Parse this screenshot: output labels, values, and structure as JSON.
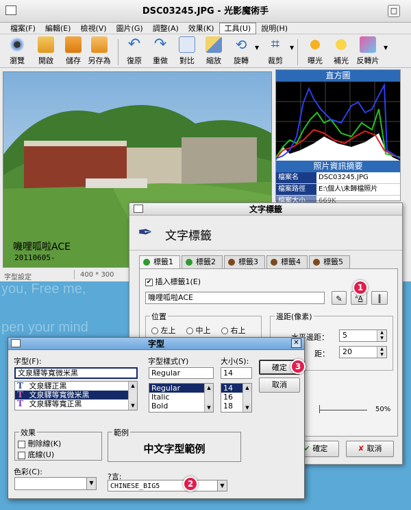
{
  "window": {
    "title": "DSC03245.JPG - 光影魔術手"
  },
  "menu": [
    "檔案(F)",
    "編輯(E)",
    "檢視(V)",
    "圖片(G)",
    "調整(A)",
    "效果(K)",
    "工具(U)",
    "說明(H)"
  ],
  "menu_active_index": 6,
  "toolbar": [
    {
      "label": "瀏覽",
      "icon": "eye-icon"
    },
    {
      "label": "開啟",
      "icon": "folder-icon"
    },
    {
      "label": "儲存",
      "icon": "save-icon"
    },
    {
      "label": "另存為",
      "icon": "save-as-icon"
    },
    {
      "label": "復原",
      "icon": "undo-icon"
    },
    {
      "label": "重做",
      "icon": "redo-icon"
    },
    {
      "label": "對比",
      "icon": "compare-icon"
    },
    {
      "label": "縮放",
      "icon": "resize-icon"
    },
    {
      "label": "旋轉",
      "icon": "rotate-icon"
    },
    {
      "label": "裁剪",
      "icon": "crop-icon"
    },
    {
      "label": "曝光",
      "icon": "exposure-icon"
    },
    {
      "label": "補光",
      "icon": "fill-light-icon"
    },
    {
      "label": "反轉片",
      "icon": "reversal-film-icon"
    }
  ],
  "photo": {
    "caption": "嘰哩呱啦ACE",
    "date": "20110605-"
  },
  "status": {
    "left": "字型設定",
    "size": "400 * 300"
  },
  "side": {
    "histogram_title": "直方圖",
    "info_title": "照片資訊摘要",
    "rows": [
      {
        "k": "檔案名",
        "v": "DSC03245.JPG"
      },
      {
        "k": "檔案路徑",
        "v": "E:\\個人\\未歸檔照片"
      },
      {
        "k": "檔案大小",
        "v": "669K"
      }
    ]
  },
  "background_text": [
    "you, Free me,",
    "pen your mind"
  ],
  "text_dialog": {
    "title": "文字標籤",
    "header": "文字標籤",
    "tabs": [
      {
        "label": "標籤1",
        "color": "#2f9a2f"
      },
      {
        "label": "標籤2",
        "color": "#2f9a2f"
      },
      {
        "label": "標籤3",
        "color": "#7a4a1e"
      },
      {
        "label": "標籤4",
        "color": "#7a4a1e"
      },
      {
        "label": "標籤5",
        "color": "#7a4a1e"
      }
    ],
    "insert_label": "插入標籤1(E)",
    "text_value": "嘰哩呱啦ACE",
    "position_label": "位置",
    "positions": [
      "左上",
      "中上",
      "右上"
    ],
    "margin_label": "邊距(像素)",
    "h_margin_label": "水平邊距：",
    "h_margin": "5",
    "v_margin_label": "距：",
    "v_margin": "20",
    "opacity_value": "50%",
    "ok": "確定",
    "cancel": "取消"
  },
  "font_dialog": {
    "title": "字型",
    "font_label": "字型(F):",
    "font_value": "文泉驛等寬微米黑",
    "fonts": [
      "文泉驛正黑",
      "文泉驛等寬微米黑",
      "文泉驛等寬正黑"
    ],
    "font_selected": 1,
    "style_label": "字型樣式(Y)",
    "style_value": "Regular",
    "styles": [
      "Regular",
      "Italic",
      "Bold"
    ],
    "size_label": "大小(S):",
    "size_value": "14",
    "sizes": [
      "14",
      "16",
      "18"
    ],
    "ok": "確定",
    "cancel": "取消",
    "effects_label": "效果",
    "strike_label": "刪除線(K)",
    "underline_label": "底線(U)",
    "sample_label": "範例",
    "sample_text": "中文字型範例",
    "color_label": "色彩(C):",
    "script_label": "?言:",
    "script_value": "CHINESE_BIG5"
  },
  "badges": [
    "1",
    "2",
    "3"
  ],
  "colors": {
    "accent": "#2c6ab7",
    "badge": "#e01e4e",
    "list_selection": "#142a68"
  }
}
